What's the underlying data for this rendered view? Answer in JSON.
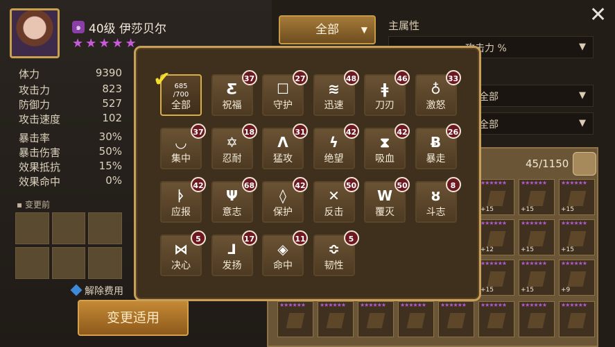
{
  "character": {
    "level_name": "40级 伊莎贝尔",
    "stars": "★★★★★",
    "element_icon": "wind-element-icon",
    "stats": [
      {
        "label": "体力",
        "value": "9390"
      },
      {
        "label": "攻击力",
        "value": "823"
      },
      {
        "label": "防御力",
        "value": "527"
      },
      {
        "label": "攻击速度",
        "value": "102"
      },
      {
        "label": "暴击率",
        "value": "30%"
      },
      {
        "label": "暴击伤害",
        "value": "50%"
      },
      {
        "label": "效果抵抗",
        "value": "15%"
      },
      {
        "label": "效果命中",
        "value": "0%"
      }
    ],
    "before_label": "变更前",
    "fee_label": "解除费用",
    "apply_button": "变更适用"
  },
  "filters": {
    "set_filter": "全部",
    "main_attr_title": "主属性",
    "main_attr_value": "攻击力 %",
    "sub_filter_1": "全部",
    "sub_filter_2": "全部"
  },
  "inventory": {
    "count": "45/1150",
    "plus_levels": [
      "+15",
      "+15",
      "+15",
      "+12",
      "+15",
      "+15",
      "+15",
      "+15",
      "+9"
    ]
  },
  "rune_sets": {
    "all": {
      "label": "全部",
      "count_top": "685",
      "count_bottom": "/700"
    },
    "sets": [
      {
        "label": "祝福",
        "icon": "Ƹ",
        "count": "37"
      },
      {
        "label": "守护",
        "icon": "☐",
        "count": "27"
      },
      {
        "label": "迅速",
        "icon": "≋",
        "count": "48"
      },
      {
        "label": "刀刃",
        "icon": "ǂ",
        "count": "46"
      },
      {
        "label": "激怒",
        "icon": "♁",
        "count": "33"
      },
      {
        "label": "集中",
        "icon": "◡",
        "count": "37"
      },
      {
        "label": "忍耐",
        "icon": "✡",
        "count": "18"
      },
      {
        "label": "猛攻",
        "icon": "Λ",
        "count": "31"
      },
      {
        "label": "绝望",
        "icon": "ϟ",
        "count": "42"
      },
      {
        "label": "吸血",
        "icon": "⧗",
        "count": "42"
      },
      {
        "label": "暴走",
        "icon": "Ƀ",
        "count": "26"
      },
      {
        "label": "应报",
        "icon": "ᚦ",
        "count": "42"
      },
      {
        "label": "意志",
        "icon": "Ψ",
        "count": "68"
      },
      {
        "label": "保护",
        "icon": "◊",
        "count": "42"
      },
      {
        "label": "反击",
        "icon": "✕",
        "count": "50"
      },
      {
        "label": "覆灭",
        "icon": "W",
        "count": "50"
      },
      {
        "label": "斗志",
        "icon": "ȣ",
        "count": "8"
      },
      {
        "label": "决心",
        "icon": "⋈",
        "count": "5"
      },
      {
        "label": "发扬",
        "icon": "ᒧ",
        "count": "17"
      },
      {
        "label": "命中",
        "icon": "◈",
        "count": "11"
      },
      {
        "label": "韧性",
        "icon": "≎",
        "count": "5"
      }
    ]
  }
}
